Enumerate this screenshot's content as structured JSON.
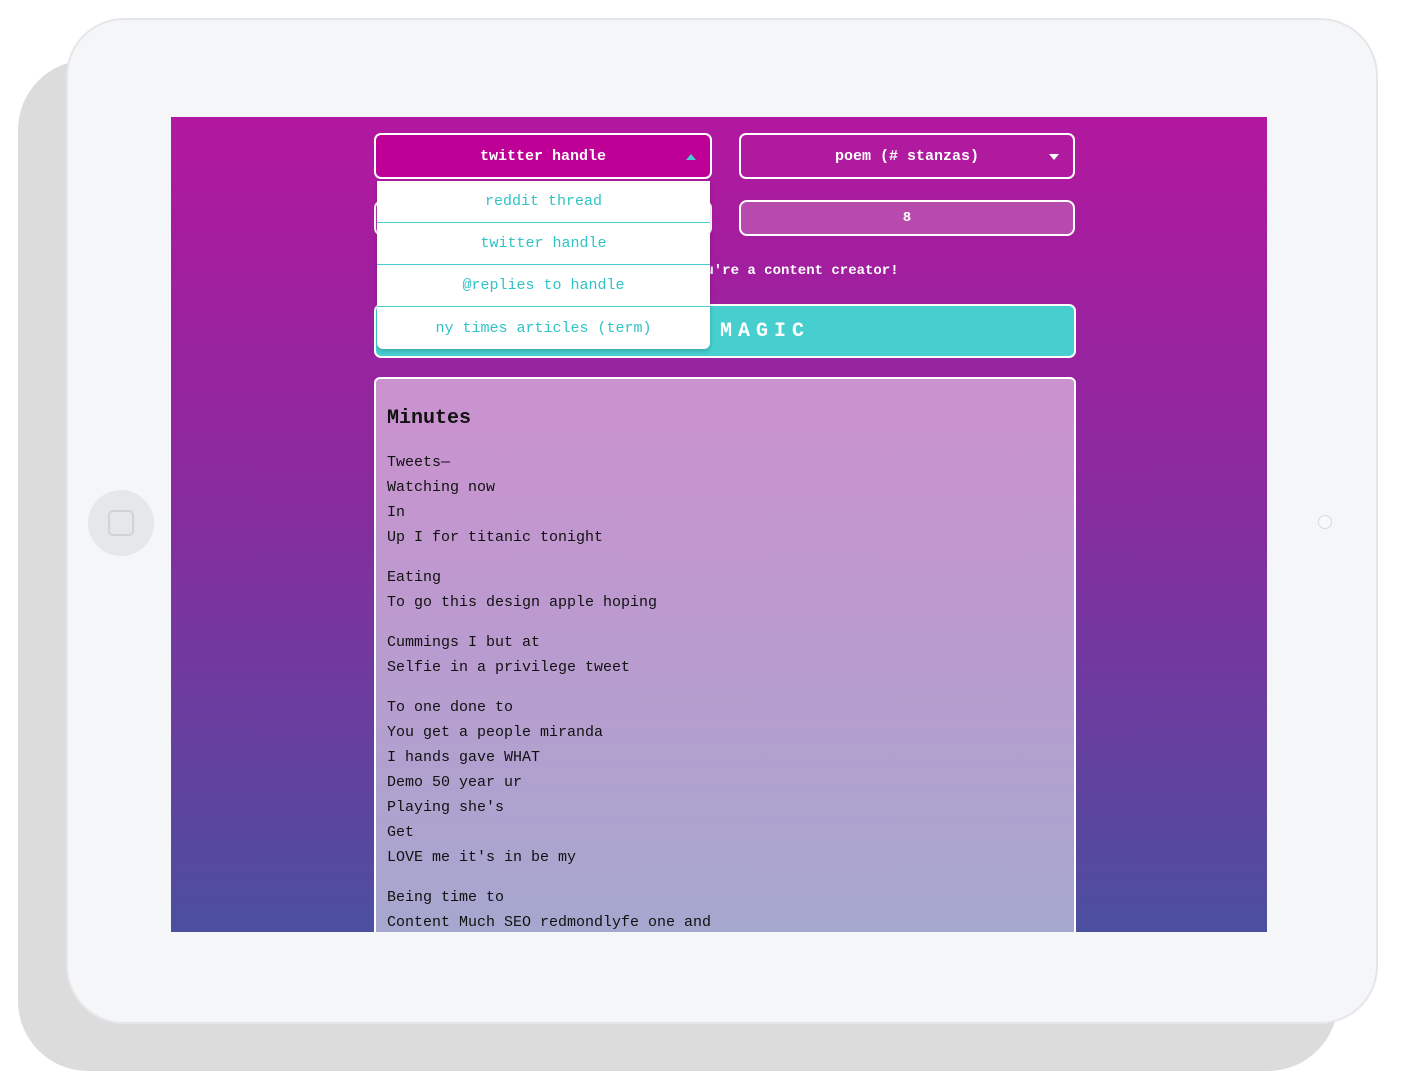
{
  "source_select": {
    "value": "twitter handle",
    "options": [
      "reddit thread",
      "twitter handle",
      "@replies to handle",
      "ny times articles (term)"
    ]
  },
  "format_select": {
    "value": "poem (# stanzas)"
  },
  "stanzas_input": {
    "value": "8"
  },
  "tagline": "u're a content creator!",
  "magic_button": {
    "label": "MAGIC"
  },
  "poem": {
    "title": "Minutes",
    "stanzas": [
      [
        "Tweets—",
        "Watching now",
        "In",
        "Up I for titanic tonight"
      ],
      [
        "Eating",
        "To go this design apple hoping"
      ],
      [
        "Cummings I but at",
        "Selfie in a privilege tweet"
      ],
      [
        "To one done to",
        "You get a people miranda",
        "I hands gave WHAT",
        "Demo 50 year ur",
        "Playing she's",
        "Get",
        "LOVE me it's in be my"
      ],
      [
        "Being time to",
        "Content Much SEO redmondlyfe one and"
      ]
    ]
  },
  "icons": {
    "source_caret": "caret-up-icon",
    "format_caret": "caret-down-icon",
    "home": "home-button-icon",
    "camera": "camera-dot-icon"
  },
  "colors": {
    "gradient_top": "#b2179f",
    "gradient_bottom": "#4b4f9f",
    "accent_teal": "#47cfd0",
    "active_select": "#bf0096"
  }
}
